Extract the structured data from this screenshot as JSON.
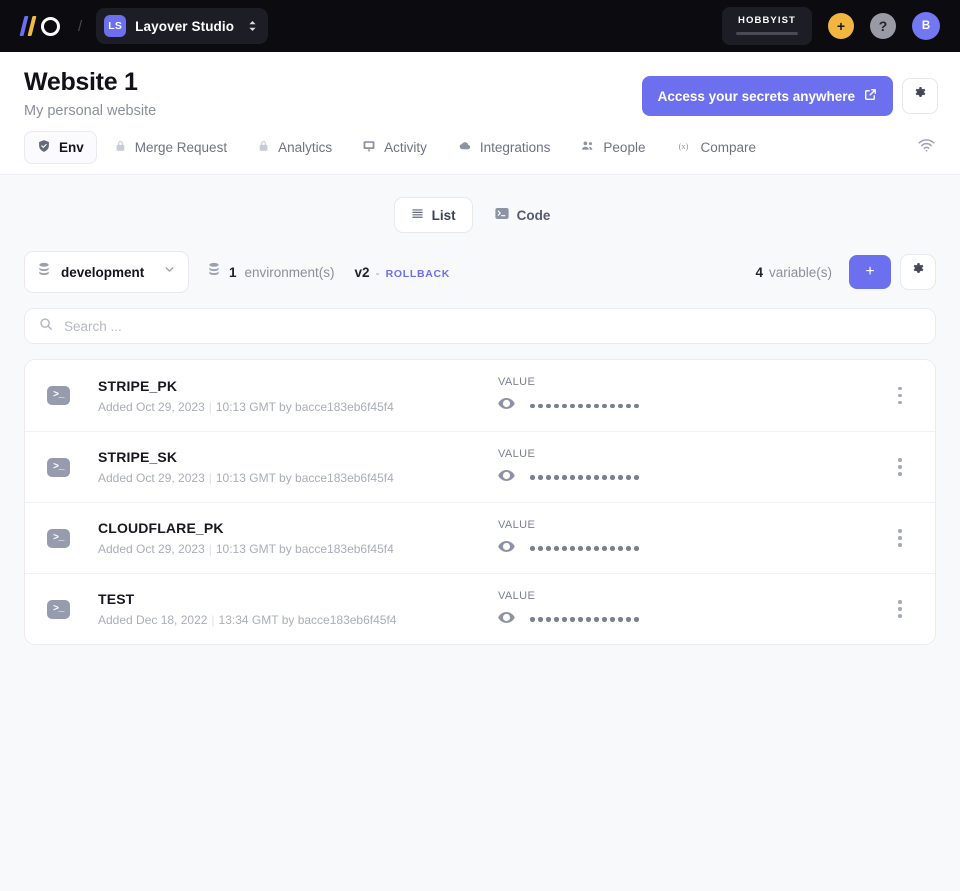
{
  "topbar": {
    "logo_name": "io-logo",
    "separator": "/",
    "workspace": {
      "initials": "LS",
      "name": "Layover Studio"
    },
    "plan": {
      "label": "HOBBYIST"
    },
    "add_label": "+",
    "help_label": "?",
    "avatar_initial": "B"
  },
  "header": {
    "title": "Website 1",
    "subtitle": "My personal website",
    "primary_button": "Access your secrets anywhere",
    "settings_icon": "gear-icon"
  },
  "tabs": [
    {
      "label": "Env",
      "icon": "shield-icon",
      "active": true,
      "locked": false
    },
    {
      "label": "Merge Request",
      "icon": "lock-icon",
      "active": false,
      "locked": true
    },
    {
      "label": "Analytics",
      "icon": "lock-icon",
      "active": false,
      "locked": true
    },
    {
      "label": "Activity",
      "icon": "presentation-icon",
      "active": false,
      "locked": false
    },
    {
      "label": "Integrations",
      "icon": "cloud-icon",
      "active": false,
      "locked": false
    },
    {
      "label": "People",
      "icon": "people-icon",
      "active": false,
      "locked": false
    },
    {
      "label": "Compare",
      "icon": "variable-icon",
      "active": false,
      "locked": false
    }
  ],
  "wifi_icon": "wifi-icon",
  "view_toggle": [
    {
      "label": "List",
      "icon": "list-icon",
      "active": true
    },
    {
      "label": "Code",
      "icon": "terminal-icon",
      "active": false
    }
  ],
  "toolbar": {
    "environment": "development",
    "env_count": "1",
    "env_count_label": "environment(s)",
    "version": "v2",
    "version_dash": "-",
    "rollback": "ROLLBACK",
    "variable_count": "4",
    "variable_count_label": "variable(s)",
    "add_label": "+",
    "settings_icon": "gear-icon"
  },
  "search": {
    "placeholder": "Search ...",
    "value": "",
    "icon": "search-icon"
  },
  "list": {
    "value_column_label": "VALUE",
    "masked_dots": 14,
    "rows": [
      {
        "name": "STRIPE_PK",
        "meta_prefix": "Added Oct 29, 2023",
        "meta_suffix": "10:13 GMT by bacce183eb6f45f4",
        "value_label": "VALUE"
      },
      {
        "name": "STRIPE_SK",
        "meta_prefix": "Added Oct 29, 2023",
        "meta_suffix": "10:13 GMT by bacce183eb6f45f4",
        "value_label": "VALUE"
      },
      {
        "name": "CLOUDFLARE_PK",
        "meta_prefix": "Added Oct 29, 2023",
        "meta_suffix": "10:13 GMT by bacce183eb6f45f4",
        "value_label": "VALUE"
      },
      {
        "name": "TEST",
        "meta_prefix": "Added Dec 18, 2022",
        "meta_suffix": "13:34 GMT by bacce183eb6f45f4",
        "value_label": "VALUE"
      }
    ]
  },
  "colors": {
    "accent": "#6c70ee",
    "topbar_bg": "#0c0c10",
    "page_bg": "#f8f9fb",
    "amber": "#f0b63f"
  }
}
